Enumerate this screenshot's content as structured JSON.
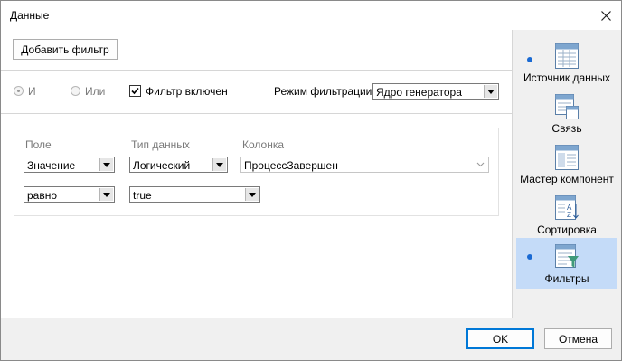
{
  "window": {
    "title": "Данные"
  },
  "toolbar": {
    "add_filter_label": "Добавить фильтр"
  },
  "logic": {
    "and_label": "И",
    "or_label": "Или",
    "filter_enabled_label": "Фильтр включен",
    "filter_enabled": true,
    "mode_label": "Режим фильтрации",
    "mode_value": "Ядро генератора"
  },
  "filter": {
    "headers": {
      "field": "Поле",
      "data_type": "Тип данных",
      "column": "Колонка"
    },
    "field_value": "Значение",
    "data_type_value": "Логический",
    "column_value": "ПроцессЗавершен",
    "operator_value": "равно",
    "operand_value": "true"
  },
  "sidebar": {
    "items": [
      {
        "label": "Источник данных",
        "icon": "data-source-icon",
        "marked": true,
        "active": false
      },
      {
        "label": "Связь",
        "icon": "relation-icon",
        "marked": false,
        "active": false
      },
      {
        "label": "Мастер компонент",
        "icon": "component-wizard-icon",
        "marked": false,
        "active": false
      },
      {
        "label": "Сортировка",
        "icon": "sort-icon",
        "marked": false,
        "active": false
      },
      {
        "label": "Фильтры",
        "icon": "filter-icon",
        "marked": true,
        "active": true
      }
    ]
  },
  "footer": {
    "ok_label": "OK",
    "cancel_label": "Отмена"
  },
  "colors": {
    "accent": "#0078d7",
    "selection": "#c4dbf8",
    "marker": "#1a6ad3"
  }
}
